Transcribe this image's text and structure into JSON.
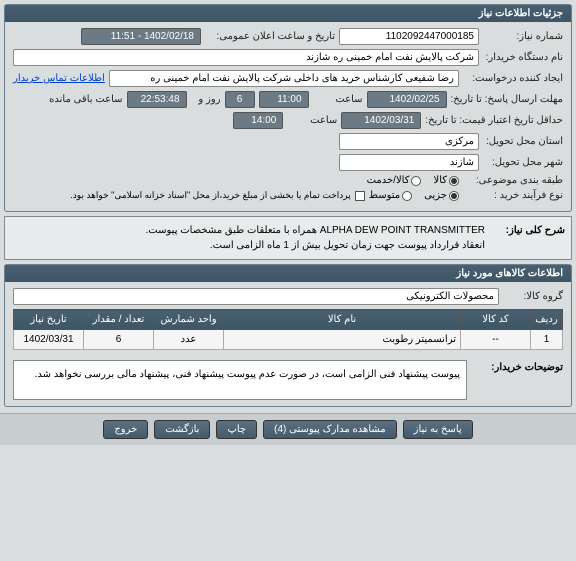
{
  "panel1": {
    "title": "جزئیات اطلاعات نیاز",
    "need_no_lbl": "شماره نیاز:",
    "need_no": "1102092447000185",
    "announce_lbl": "تاریخ و ساعت اعلان عمومی:",
    "announce_val": "1402/02/18 - 11:51",
    "buyer_lbl": "نام دستگاه خریدار:",
    "buyer_val": "شرکت پالایش نفت امام خمینی  ره  شازند",
    "requester_lbl": "ایجاد کننده درخواست:",
    "requester_val": "رضا  شفیعی  کارشناس خرید های داخلی  شرکت پالایش نفت امام خمینی  ره",
    "contact_link": "اطلاعات تماس خریدار",
    "deadline_lbl": "مهلت ارسال پاسخ: تا تاریخ:",
    "deadline_date": "1402/02/25",
    "time_lbl": "ساعت",
    "deadline_time": "11:00",
    "day_lbl": "روز و",
    "days": "6",
    "countdown": "22:53:48",
    "remain": "ساعت باقی مانده",
    "validity_lbl": "حداقل تاریخ اعتبار قیمت: تا تاریخ:",
    "validity_date": "1402/03/31",
    "validity_time": "14:00",
    "state_lbl": "استان محل تحویل:",
    "state_val": "مرکزی",
    "city_lbl": "شهر محل تحویل:",
    "city_val": "شازند",
    "category_lbl": "طبقه بندی موضوعی:",
    "cat_goods": "کالا",
    "cat_service": "کالا/خدمت",
    "process_lbl": "نوع فرآیند خرید :",
    "proc_small": "جزیی",
    "proc_med": "متوسط",
    "pay_note": "پرداخت تمام یا بخشی از مبلغ خرید،از محل \"اسناد خزانه اسلامی\" خواهد بود."
  },
  "desc": {
    "lbl": "شرح کلی نیاز:",
    "line1": "ALPHA DEW POINT TRANSMITTER همراه با متعلقات طبق مشخصات پیوست.",
    "line2": "انعقاد قرارداد پیوست جهت زمان تحویل بیش از 1 ماه الزامی است."
  },
  "panel2": {
    "title": "اطلاعات کالاهای مورد نیاز",
    "group_lbl": "گروه کالا:",
    "group_val": "محصولات الکترونیکی",
    "cols": {
      "row": "ردیف",
      "code": "کد کالا",
      "name": "نام کالا",
      "unit": "واحد شمارش",
      "qty": "تعداد / مقدار",
      "date": "تاریخ نیاز"
    },
    "rows": [
      {
        "row": "1",
        "code": "--",
        "name": "ترانسمیتر رطوبت",
        "unit": "عدد",
        "qty": "6",
        "date": "1402/03/31"
      }
    ],
    "note_lbl": "توضیحات خریدار:",
    "note_text": "پیوست پیشنهاد فنی الزامی است، در صورت عدم پیوست پیشنهاد فنی، پیشنهاد مالی بررسی نخواهد شد."
  },
  "buttons": {
    "respond": "پاسخ به نیاز",
    "attach": "مشاهده مدارک پیوستی (4)",
    "print": "چاپ",
    "back": "بازگشت",
    "exit": "خروج"
  }
}
